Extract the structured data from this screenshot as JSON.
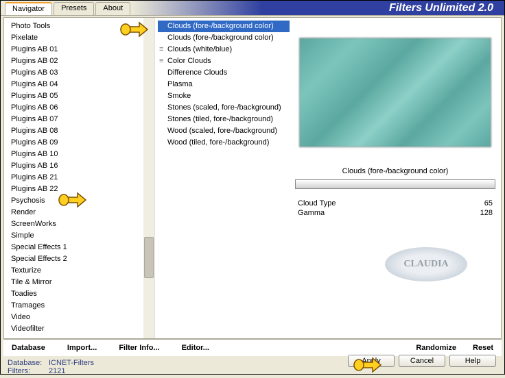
{
  "header": {
    "tabs": [
      "Navigator",
      "Presets",
      "About"
    ],
    "active_tab": 0,
    "title": "Filters Unlimited 2.0"
  },
  "categories": [
    "Photo Tools",
    "Pixelate",
    "Plugins AB 01",
    "Plugins AB 02",
    "Plugins AB 03",
    "Plugins AB 04",
    "Plugins AB 05",
    "Plugins AB 06",
    "Plugins AB 07",
    "Plugins AB 08",
    "Plugins AB 09",
    "Plugins AB 10",
    "Plugins AB 16",
    "Plugins AB 21",
    "Plugins AB 22",
    "Psychosis",
    "Render",
    "ScreenWorks",
    "Simple",
    "Special Effects 1",
    "Special Effects 2",
    "Texturize",
    "Tile & Mirror",
    "Toadies",
    "Tramages",
    "Video",
    "Videofilter"
  ],
  "selected_category_index": 16,
  "filters": [
    {
      "label": "Clouds (fore-/background color)",
      "marker": ""
    },
    {
      "label": "Clouds (fore-/background color)",
      "marker": ""
    },
    {
      "label": "Clouds (white/blue)",
      "marker": "≡"
    },
    {
      "label": "Color Clouds",
      "marker": "≡"
    },
    {
      "label": "Difference Clouds",
      "marker": ""
    },
    {
      "label": "Plasma",
      "marker": ""
    },
    {
      "label": "Smoke",
      "marker": ""
    },
    {
      "label": "Stones (scaled, fore-/background)",
      "marker": ""
    },
    {
      "label": "Stones (tiled, fore-/background)",
      "marker": ""
    },
    {
      "label": "Wood (scaled, fore-/background)",
      "marker": ""
    },
    {
      "label": "Wood (tiled, fore-/background)",
      "marker": ""
    }
  ],
  "selected_filter_index": 0,
  "preview": {
    "label": "Clouds (fore-/background color)"
  },
  "params": [
    {
      "name": "Cloud Type",
      "value": "65"
    },
    {
      "name": "Gamma",
      "value": "128"
    }
  ],
  "bottom_buttons": {
    "left": [
      "Database",
      "Import...",
      "Filter Info...",
      "Editor..."
    ],
    "right": [
      "Randomize",
      "Reset"
    ]
  },
  "status": {
    "database_label": "Database:",
    "database_value": "ICNET-Filters",
    "filters_label": "Filters:",
    "filters_value": "2121"
  },
  "dialog_buttons": [
    "Apply",
    "Cancel",
    "Help"
  ],
  "watermark_text": "CLAUDIA"
}
